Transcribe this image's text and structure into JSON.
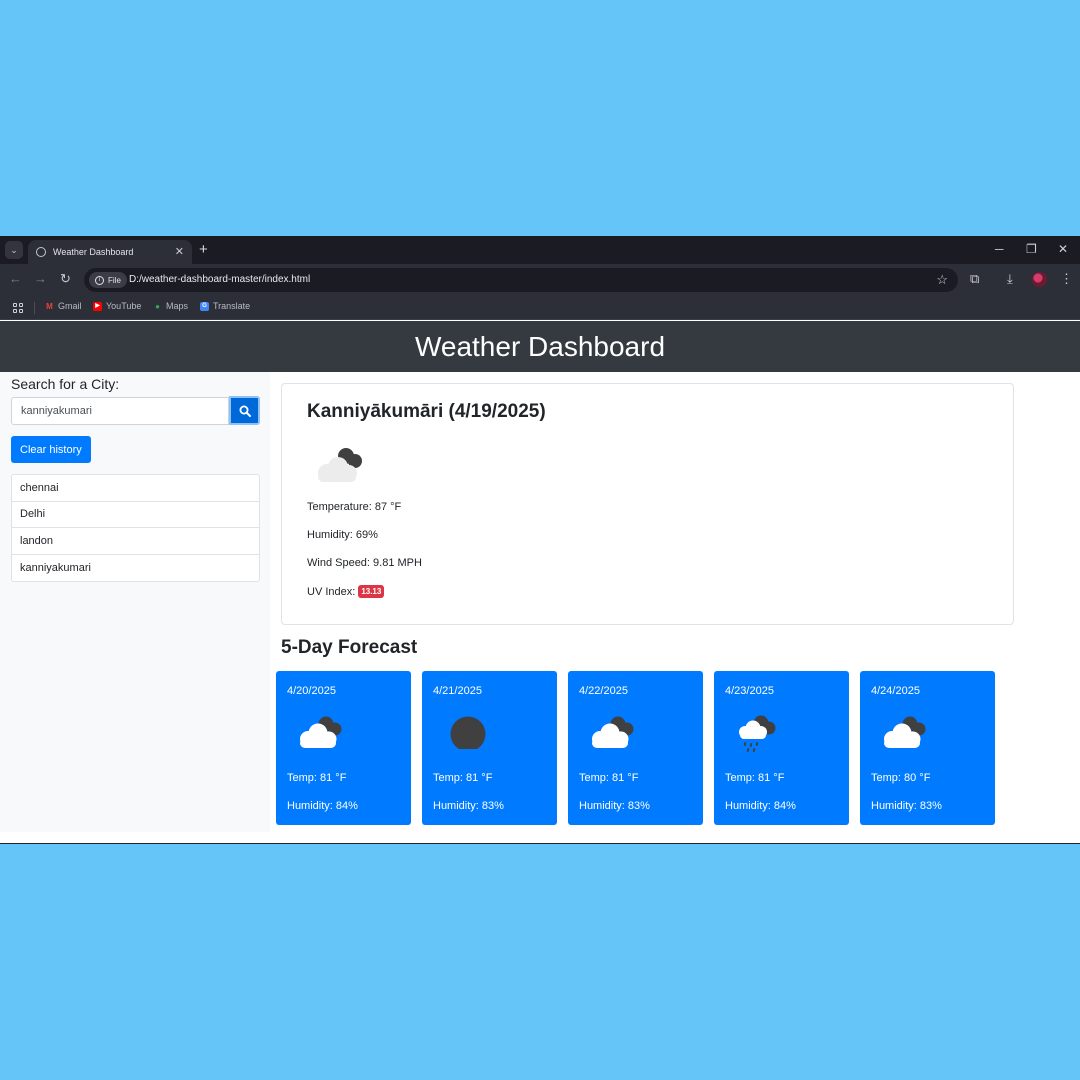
{
  "browser": {
    "tab_title": "Weather Dashboard",
    "new_tab_glyph": "+",
    "url_chip": "File",
    "url": "D:/weather-dashboard-master/index.html",
    "bookmarks": [
      {
        "label": "Gmail",
        "icon": "gmail-icon"
      },
      {
        "label": "YouTube",
        "icon": "youtube-icon"
      },
      {
        "label": "Maps",
        "icon": "maps-icon"
      },
      {
        "label": "Translate",
        "icon": "translate-icon"
      }
    ]
  },
  "header": {
    "title": "Weather Dashboard"
  },
  "sidebar": {
    "search_label": "Search for a City:",
    "search_value": "kanniyakumari",
    "clear_label": "Clear history",
    "history": [
      "chennai",
      "Delhi",
      "landon",
      "kanniyakumari"
    ]
  },
  "current": {
    "title": "Kanniyākumāri (4/19/2025)",
    "icon": "cloudy-icon",
    "temperature": "Temperature: 87 °F",
    "humidity": "Humidity: 69%",
    "wind": "Wind Speed: 9.81 MPH",
    "uv_label": "UV Index:",
    "uv_value": "13.13"
  },
  "forecast": {
    "heading": "5-Day Forecast",
    "days": [
      {
        "date": "4/20/2025",
        "icon": "cloudy-icon",
        "temp": "Temp: 81 °F",
        "humidity": "Humidity: 84%"
      },
      {
        "date": "4/21/2025",
        "icon": "overcast-icon",
        "temp": "Temp: 81 °F",
        "humidity": "Humidity: 83%"
      },
      {
        "date": "4/22/2025",
        "icon": "cloudy-icon",
        "temp": "Temp: 81 °F",
        "humidity": "Humidity: 83%"
      },
      {
        "date": "4/23/2025",
        "icon": "rain-icon",
        "temp": "Temp: 81 °F",
        "humidity": "Humidity: 84%"
      },
      {
        "date": "4/24/2025",
        "icon": "cloudy-icon",
        "temp": "Temp: 80 °F",
        "humidity": "Humidity: 83%"
      }
    ]
  },
  "colors": {
    "header": "#343a40",
    "primary": "#007bff",
    "uv_badge": "#dc3545",
    "backdrop": "#66c5f8"
  }
}
